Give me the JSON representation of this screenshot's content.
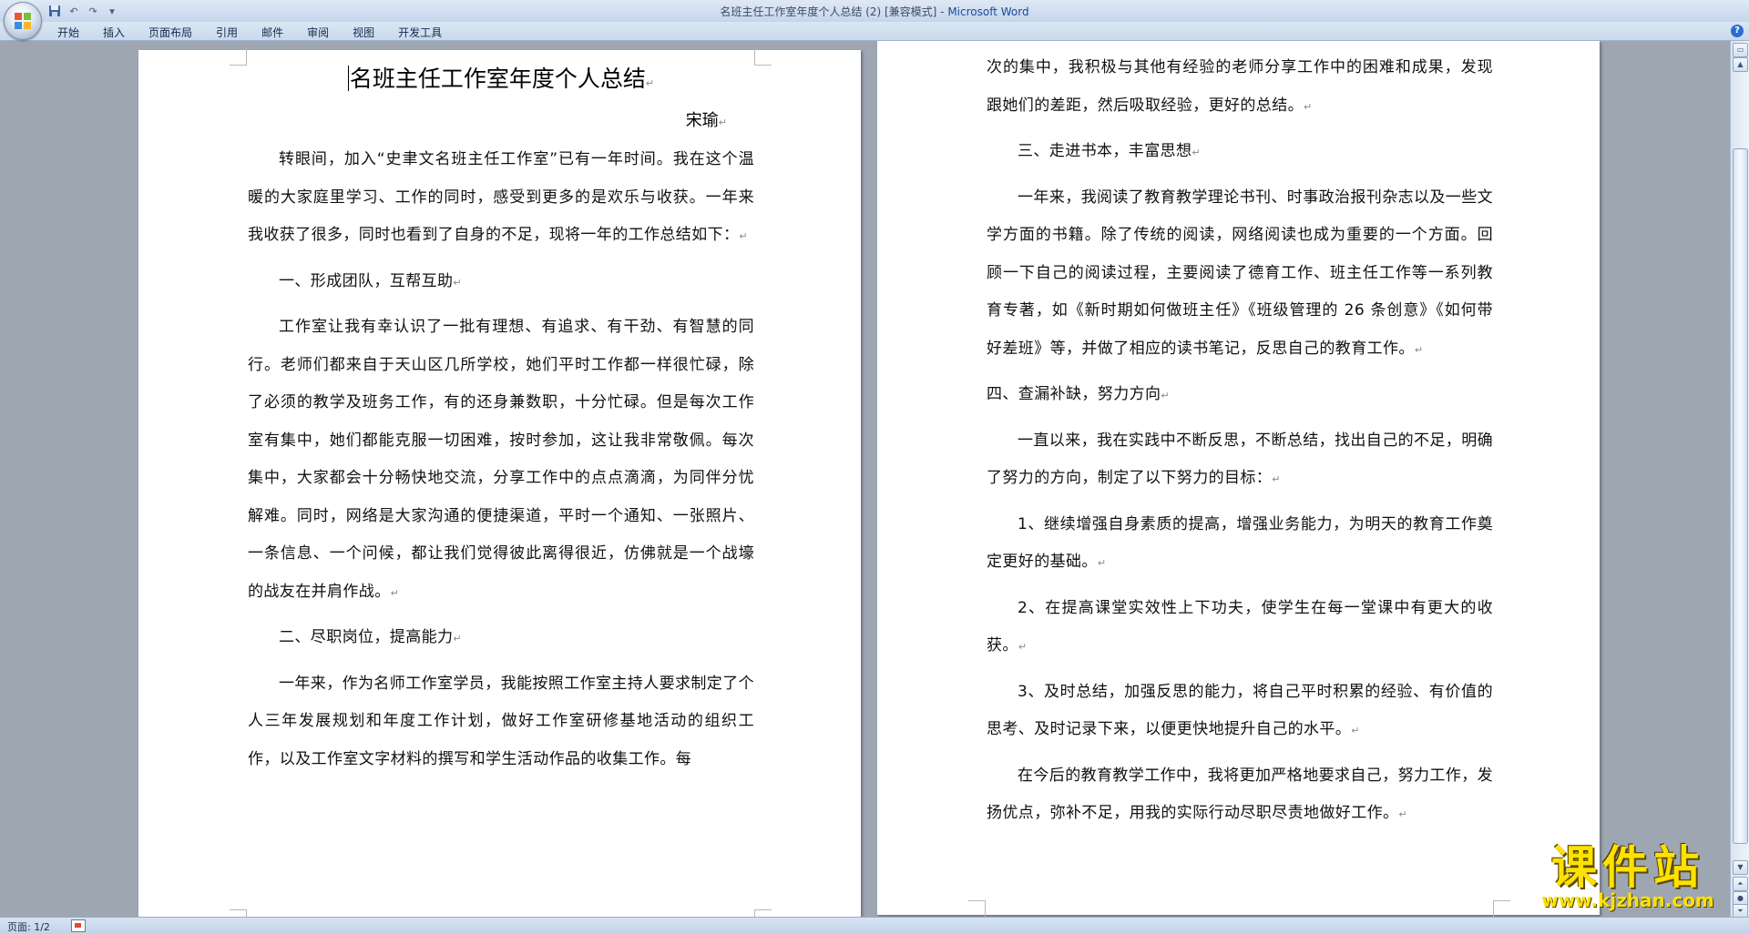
{
  "window": {
    "title_doc": "名班主任工作室年度个人总结 (2) [兼容模式] - ",
    "title_app": "Microsoft Word"
  },
  "qat": {
    "save": "💾",
    "undo": "↶",
    "redo": "↷",
    "more": "▾"
  },
  "ribbon": {
    "tabs": [
      "开始",
      "插入",
      "页面布局",
      "引用",
      "邮件",
      "审阅",
      "视图",
      "开发工具"
    ],
    "help": "?"
  },
  "document": {
    "title": "名班主任工作室年度个人总结",
    "author": "宋瑜",
    "left_paragraphs": [
      {
        "text": "转眼间，加入“史聿文名班主任工作室”已有一年时间。我在这个温暖的大家庭里学习、工作的同时，感受到更多的是欢乐与收获。一年来我收获了很多，同时也看到了自身的不足，现将一年的工作总结如下：",
        "indent": true
      },
      {
        "text": "一、形成团队，互帮互助",
        "indent": true
      },
      {
        "text": "工作室让我有幸认识了一批有理想、有追求、有干劲、有智慧的同行。老师们都来自于天山区几所学校，她们平时工作都一样很忙碌，除了必须的教学及班务工作，有的还身兼数职，十分忙碌。但是每次工作室有集中，她们都能克服一切困难，按时参加，这让我非常敬佩。每次集中，大家都会十分畅快地交流，分享工作中的点点滴滴，为同伴分忧解难。同时，网络是大家沟通的便捷渠道，平时一个通知、一张照片、一条信息、一个问候，都让我们觉得彼此离得很近，仿佛就是一个战壕的战友在并肩作战。",
        "indent": true
      },
      {
        "text": "二、尽职岗位，提高能力",
        "indent": true
      },
      {
        "text": "一年来，作为名师工作室学员，我能按照工作室主持人要求制定了个人三年发展规划和年度工作计划，做好工作室研修基地活动的组织工作，以及工作室文字材料的撰写和学生活动作品的收集工作。每",
        "indent": true,
        "end_mark": false
      }
    ],
    "right_paragraphs": [
      {
        "text": "次的集中，我积极与其他有经验的老师分享工作中的困难和成果，发现跟她们的差距，然后吸取经验，更好的总结。",
        "indent": false
      },
      {
        "text": "三、走进书本，丰富思想",
        "indent": true
      },
      {
        "text": "一年来，我阅读了教育教学理论书刊、时事政治报刊杂志以及一些文学方面的书籍。除了传统的阅读，网络阅读也成为重要的一个方面。回顾一下自己的阅读过程，主要阅读了德育工作、班主任工作等一系列教育专著，如《新时期如何做班主任》《班级管理的 26 条创意》《如何带好差班》等，并做了相应的读书笔记，反思自己的教育工作。",
        "indent": true
      },
      {
        "text": "四、查漏补缺，努力方向",
        "indent": false
      },
      {
        "text": "一直以来，我在实践中不断反思，不断总结，找出自己的不足，明确了努力的方向，制定了以下努力的目标：",
        "indent": true
      },
      {
        "text": "1、继续增强自身素质的提高，增强业务能力，为明天的教育工作奠定更好的基础。",
        "indent": true
      },
      {
        "text": "2、在提高课堂实效性上下功夫，使学生在每一堂课中有更大的收获。",
        "indent": true
      },
      {
        "text": "3、及时总结，加强反思的能力，将自己平时积累的经验、有价值的思考、及时记录下来，以便更快地提升自己的水平。",
        "indent": true
      },
      {
        "text": "在今后的教育教学工作中，我将更加严格地要求自己，努力工作，发扬优点，弥补不足，用我的实际行动尽职尽责地做好工作。",
        "indent": true
      }
    ],
    "paragraph_mark": "↵"
  },
  "statusbar": {
    "page_count": "页面: 1/2"
  },
  "watermark": {
    "main": "课件站",
    "url": "www.kjzhan.com"
  },
  "colors": {
    "title_accent": "#1a4a9a",
    "watermark": "#ffe100",
    "background": "#9ea6b1"
  }
}
